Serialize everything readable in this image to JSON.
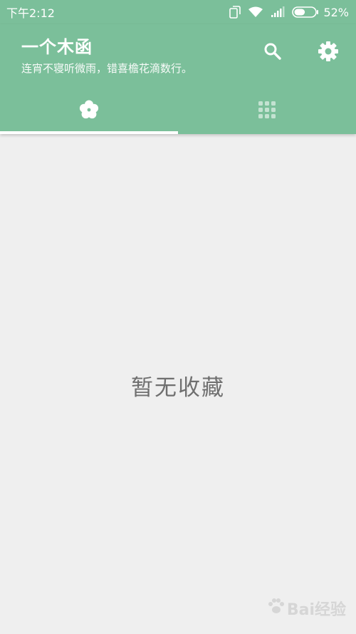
{
  "status_bar": {
    "time": "下午2:12",
    "battery_percent": "52%",
    "battery_level": 0.52,
    "icons": [
      "sim-icon",
      "wifi-icon",
      "signal-icon",
      "battery-icon"
    ]
  },
  "app_bar": {
    "title": "一个木函",
    "subtitle": "连宵不寝听微雨，错喜檐花滴数行。",
    "actions": [
      "search-icon",
      "gear-icon"
    ]
  },
  "tabs": [
    {
      "icon": "flower-icon",
      "selected": true
    },
    {
      "icon": "grid-icon",
      "selected": false
    }
  ],
  "main": {
    "empty_message": "暂无收藏"
  },
  "watermark": {
    "text": "Bai经验"
  },
  "colors": {
    "primary": "#7bbf9a",
    "background": "#efefef",
    "indicator": "#ffffff",
    "empty_text": "#6f6f6f"
  }
}
